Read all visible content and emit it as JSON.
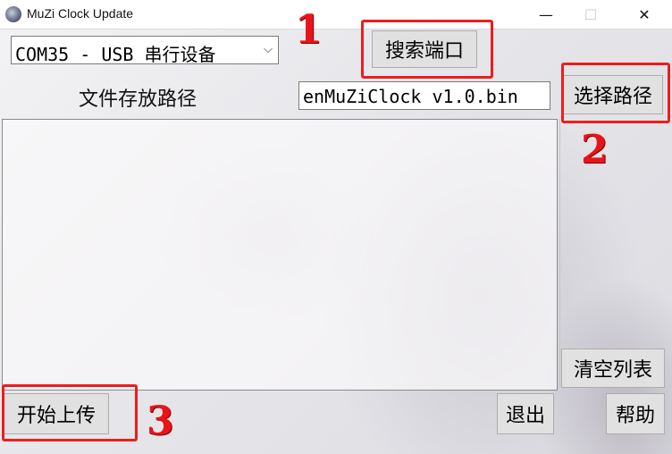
{
  "window": {
    "title": "MuZi Clock Update",
    "controls": {
      "minimize": "—",
      "maximize": "☐",
      "close": "✕"
    }
  },
  "port_select": {
    "selected": "COM35 - USB 串行设备",
    "arrow": "⌵"
  },
  "buttons": {
    "search_port": "搜索端口",
    "select_path": "选择路径",
    "clear_list": "清空列表",
    "start_upload": "开始上传",
    "exit": "退出",
    "help": "帮助"
  },
  "file_path": {
    "label": "文件存放路径",
    "value": "enMuZiClock v1.0.bin"
  },
  "log_list": {
    "items": []
  },
  "annotations": [
    {
      "number": "1"
    },
    {
      "number": "2"
    },
    {
      "number": "3"
    }
  ],
  "colors": {
    "annotation": "#ee1d1d",
    "button_bg": "#e1e1e1"
  }
}
